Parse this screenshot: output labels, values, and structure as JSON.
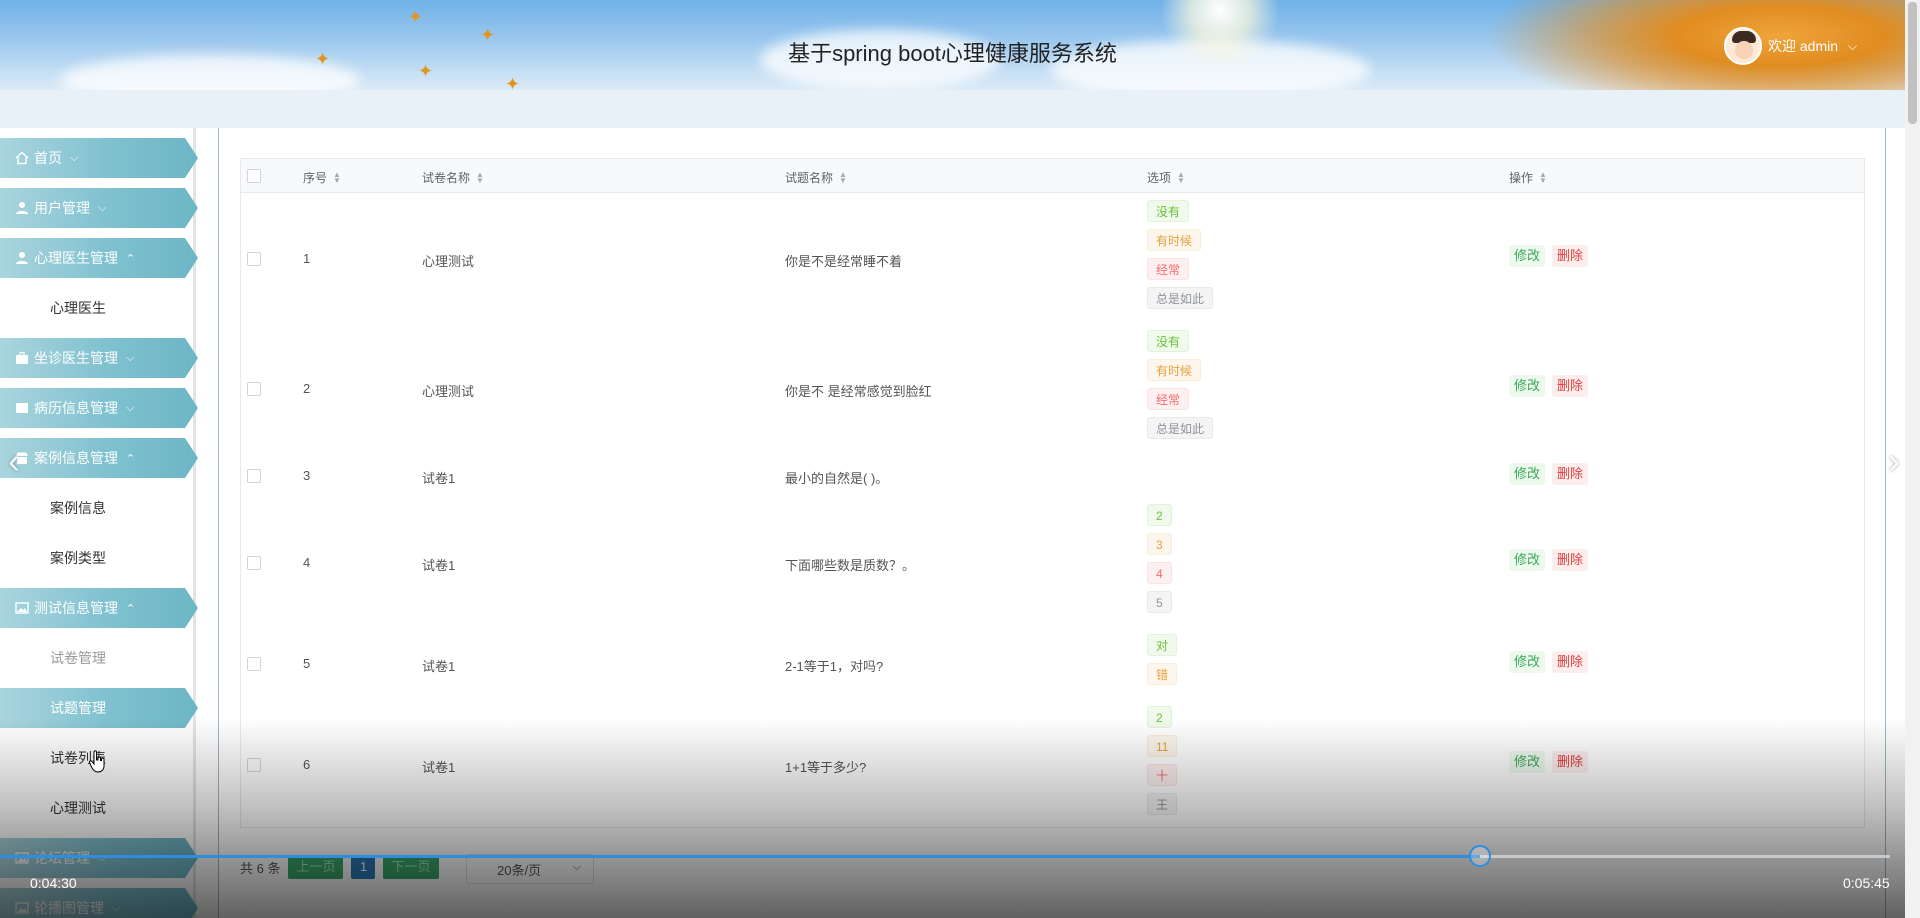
{
  "header": {
    "title": "基于spring boot心理健康服务系统",
    "welcome": "欢迎 admin"
  },
  "sidebar": {
    "menus": [
      {
        "label": "首页",
        "icon": "home-icon",
        "expanded": false
      },
      {
        "label": "用户管理",
        "icon": "user-icon",
        "expanded": false
      },
      {
        "label": "心理医生管理",
        "icon": "user-icon",
        "expanded": true,
        "children": [
          "心理医生"
        ]
      },
      {
        "label": "坐诊医生管理",
        "icon": "briefcase-icon",
        "expanded": false
      },
      {
        "label": "病历信息管理",
        "icon": "card-icon",
        "expanded": false
      },
      {
        "label": "案例信息管理",
        "icon": "shop-icon",
        "expanded": true,
        "children": [
          "案例信息",
          "案例类型"
        ]
      },
      {
        "label": "测试信息管理",
        "icon": "image-icon",
        "expanded": true,
        "children": [
          "试卷管理",
          "试题管理",
          "试卷列表",
          "心理测试"
        ]
      },
      {
        "label": "论坛管理",
        "icon": "image-icon",
        "expanded": false
      },
      {
        "label": "轮播图管理",
        "icon": "image-icon",
        "expanded": false
      }
    ],
    "active_child": "试题管理"
  },
  "table": {
    "columns": [
      "序号",
      "试卷名称",
      "试题名称",
      "选项",
      "操作"
    ],
    "rows": [
      {
        "index": "1",
        "paper": "心理测试",
        "question": "你是不是经常睡不着",
        "options": [
          "没有",
          "有时候",
          "经常",
          "总是如此"
        ]
      },
      {
        "index": "2",
        "paper": "心理测试",
        "question": "你是不 是经常感觉到脸红",
        "options": [
          "没有",
          "有时候",
          "经常",
          "总是如此"
        ]
      },
      {
        "index": "3",
        "paper": "试卷1",
        "question": "最小的自然是( )。",
        "options": []
      },
      {
        "index": "4",
        "paper": "试卷1",
        "question": "下面哪些数是质数？。",
        "options": [
          "2",
          "3",
          "4",
          "5"
        ]
      },
      {
        "index": "5",
        "paper": "试卷1",
        "question": "2-1等于1，对吗?",
        "options": [
          "对",
          "错"
        ]
      },
      {
        "index": "6",
        "paper": "试卷1",
        "question": "1+1等于多少?",
        "options": [
          "2",
          "11",
          "十",
          "王"
        ]
      }
    ],
    "edit_label": "修改",
    "delete_label": "删除"
  },
  "pagination": {
    "total_text": "共 6 条",
    "prev_label": "上一页",
    "current_page": "1",
    "next_label": "下一页",
    "page_size": "20条/页"
  },
  "video": {
    "current_time": "0:04:30",
    "total_time": "0:05:45",
    "progress": 0.783
  },
  "colors": {
    "accent": "#7fc1cf",
    "tag_green": "#67c23a",
    "tag_orange": "#e6a23c",
    "tag_red": "#f56c6c",
    "tag_gray": "#909399",
    "progress": "#2d8ee0"
  }
}
